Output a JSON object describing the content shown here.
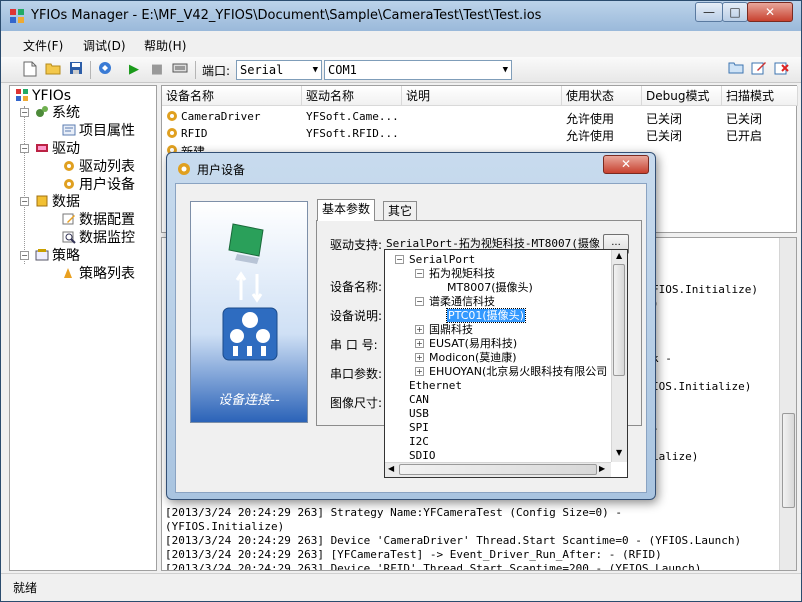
{
  "window": {
    "title": "YFIOs Manager - E:\\MF_V42_YFIOS\\Document\\Sample\\CameraTest\\Test\\Test.ios",
    "min_label": "—",
    "max_label": "□",
    "close_label": "✕"
  },
  "menu": [
    "文件(F)",
    "调试(D)",
    "帮助(H)"
  ],
  "toolbar": {
    "port_label": "端口:",
    "port_value": "Serial",
    "com_value": "COM1"
  },
  "tree": {
    "root": "YFIOs",
    "nodes": [
      "系统",
      "项目属性",
      "驱动",
      "驱动列表",
      "用户设备",
      "数据",
      "数据配置",
      "数据监控",
      "策略",
      "策略列表"
    ]
  },
  "list": {
    "columns": [
      "设备名称",
      "驱动名称",
      "说明",
      "使用状态",
      "Debug模式",
      "扫描模式"
    ],
    "rows": [
      [
        "CameraDriver",
        "YFSoft.Came...",
        "",
        "允许使用",
        "已关闭",
        "已关闭"
      ],
      [
        "RFID",
        "YFSoft.RFID...",
        "",
        "允许使用",
        "已关闭",
        "已开启"
      ],
      [
        "新建...",
        "",
        "",
        "",
        "",
        ""
      ]
    ]
  },
  "log": {
    "right_fragments": [
      "FIOS.Initialize)",
      ")",
      "k -",
      "IOS.Initialize)",
      "-",
      "ialize)"
    ],
    "lines": [
      "[2013/3/24 20:24:29 263] Strategy Name:YFCameraTest (Config Size=0) -",
      "(YFIOS.Initialize)",
      "[2013/3/24 20:24:29 263] Device 'CameraDriver' Thread.Start Scantime=0 - (YFIOS.Launch)",
      "[2013/3/24 20:24:29 263] [YFCameraTest] -> Event_Driver_Run_After: - (RFID)",
      "[2013/3/24 20:24:29 263] Device 'RFID' Thread.Start Scantime=200 - (YFIOS.Launch)"
    ]
  },
  "status": "就绪",
  "dialog": {
    "title": "用户设备",
    "close_label": "✕",
    "illustration_caption": "设备连接--",
    "tabs": [
      "基本参数",
      "其它"
    ],
    "driver_label": "驱动支持:",
    "driver_value": "SerialPort-拓为视矩科技-MT8007(摄像",
    "browse_label": "...",
    "labels": [
      "设备名称:",
      "设备说明:",
      "串 口 号:",
      "串口参数:",
      "图像尺寸:"
    ]
  },
  "popup": {
    "items": [
      {
        "text": "SerialPort",
        "level": 0,
        "exp": "−"
      },
      {
        "text": "拓为视矩科技",
        "level": 1,
        "exp": "−"
      },
      {
        "text": "MT8007(摄像头)",
        "level": 2,
        "exp": ""
      },
      {
        "text": "谱柔通信科技",
        "level": 1,
        "exp": "−"
      },
      {
        "text": "PTC01(摄像头)",
        "level": 2,
        "exp": "",
        "selected": true
      },
      {
        "text": "国鼎科技",
        "level": 1,
        "exp": "+"
      },
      {
        "text": "EUSAT(易用科技)",
        "level": 1,
        "exp": "+"
      },
      {
        "text": "Modicon(莫迪康)",
        "level": 1,
        "exp": "+"
      },
      {
        "text": "EHUOYAN(北京易火眼科技有限公司",
        "level": 1,
        "exp": "+"
      },
      {
        "text": "Ethernet",
        "level": 0,
        "exp": ""
      },
      {
        "text": "CAN",
        "level": 0,
        "exp": ""
      },
      {
        "text": "USB",
        "level": 0,
        "exp": ""
      },
      {
        "text": "SPI",
        "level": 0,
        "exp": ""
      },
      {
        "text": "I2C",
        "level": 0,
        "exp": ""
      },
      {
        "text": "SDIO",
        "level": 0,
        "exp": ""
      }
    ]
  }
}
